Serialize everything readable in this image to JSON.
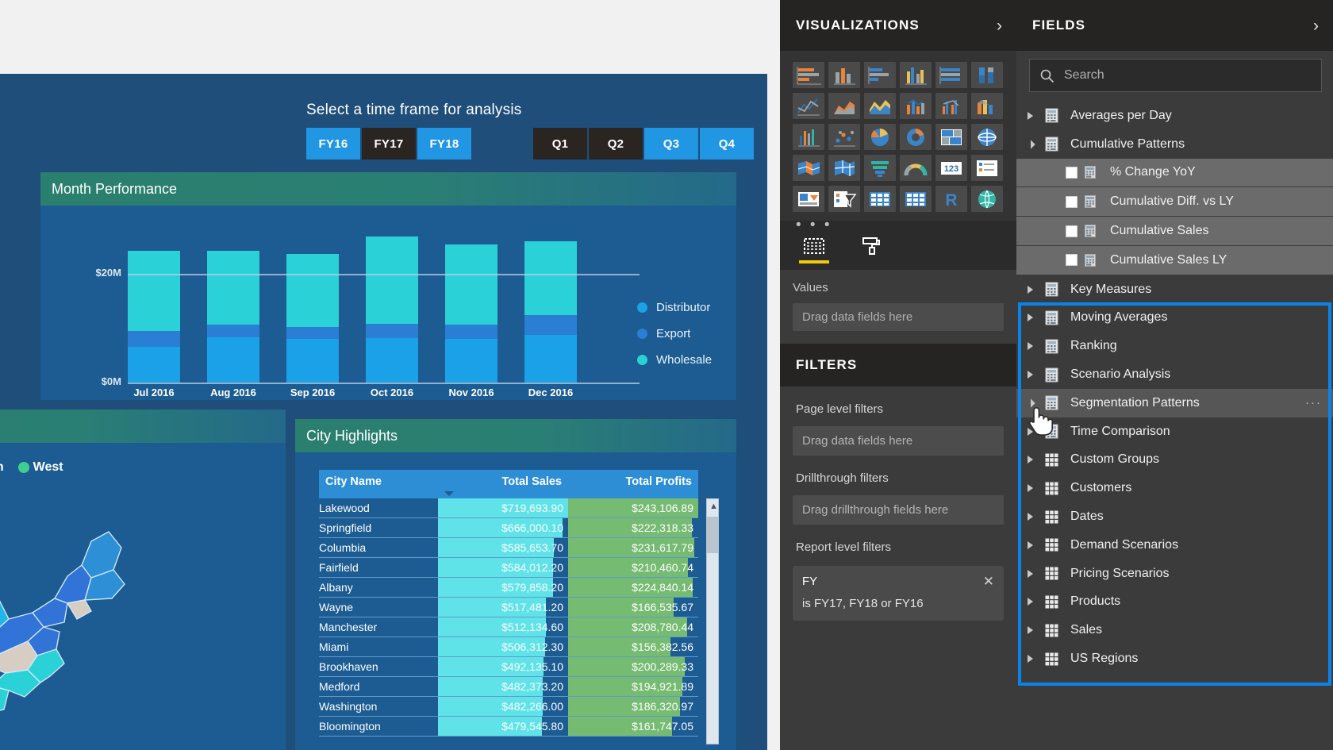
{
  "report": {
    "slicer": {
      "title": "Select a time frame for analysis",
      "fiscal_years": [
        {
          "label": "FY16",
          "selected": true
        },
        {
          "label": "FY17",
          "selected": false
        },
        {
          "label": "FY18",
          "selected": true
        }
      ],
      "quarters": [
        {
          "label": "Q1",
          "selected": false
        },
        {
          "label": "Q2",
          "selected": false
        },
        {
          "label": "Q3",
          "selected": true
        },
        {
          "label": "Q4",
          "selected": true
        }
      ]
    },
    "month_performance": {
      "title": "Month Performance"
    },
    "map_visual": {
      "legend_partial": "outh",
      "legend_west": "West"
    },
    "city_highlights": {
      "title": "City Highlights",
      "columns": [
        "City Name",
        "Total Sales",
        "Total Profits"
      ],
      "rows": [
        {
          "city": "Lakewood",
          "sales": "$719,693.90",
          "profits": "$243,106.89"
        },
        {
          "city": "Springfield",
          "sales": "$666,000.10",
          "profits": "$222,318.33"
        },
        {
          "city": "Columbia",
          "sales": "$585,653.70",
          "profits": "$231,617.79"
        },
        {
          "city": "Fairfield",
          "sales": "$584,012.20",
          "profits": "$210,460.74"
        },
        {
          "city": "Albany",
          "sales": "$579,858.20",
          "profits": "$224,840.14"
        },
        {
          "city": "Wayne",
          "sales": "$517,481.20",
          "profits": "$166,535.67"
        },
        {
          "city": "Manchester",
          "sales": "$512,134.60",
          "profits": "$208,780.44"
        },
        {
          "city": "Miami",
          "sales": "$506,312.30",
          "profits": "$156,382.56"
        },
        {
          "city": "Brookhaven",
          "sales": "$492,135.10",
          "profits": "$200,289.33"
        },
        {
          "city": "Medford",
          "sales": "$482,373.20",
          "profits": "$194,921.89"
        },
        {
          "city": "Washington",
          "sales": "$482,266.00",
          "profits": "$186,320.97"
        },
        {
          "city": "Bloomington",
          "sales": "$479,545.80",
          "profits": "$161,747.05"
        }
      ]
    }
  },
  "chart_data": {
    "type": "bar",
    "title": "Month Performance",
    "stacked": true,
    "categories": [
      "Jul 2016",
      "Aug 2016",
      "Sep 2016",
      "Oct 2016",
      "Nov 2016",
      "Dec 2016"
    ],
    "series": [
      {
        "name": "Distributor",
        "color": "#1ba1e8",
        "values": [
          6.6,
          8.4,
          8.0,
          8.2,
          8.0,
          8.8
        ]
      },
      {
        "name": "Export",
        "color": "#2a7fd4",
        "values": [
          2.9,
          2.3,
          2.2,
          2.6,
          2.7,
          3.6
        ]
      },
      {
        "name": "Wholesale",
        "color": "#2ad2d8",
        "values": [
          14.8,
          13.6,
          13.5,
          16.1,
          14.8,
          13.6
        ]
      }
    ],
    "ylabel": "",
    "xlabel": "",
    "ylim": [
      0,
      30
    ],
    "ytick_labels": [
      "$20M",
      "$0M"
    ],
    "grid": true,
    "legend_position": "right",
    "legend_entries": [
      "Distributor",
      "Export",
      "Wholesale"
    ]
  },
  "visualizations": {
    "header": "VISUALIZATIONS",
    "collapse_chevron": "›",
    "more_icons": "• • •",
    "gallery_icons": [
      "stacked-bar-chart-icon",
      "stacked-column-chart-icon",
      "clustered-bar-chart-icon",
      "clustered-column-chart-icon",
      "100-stacked-bar-chart-icon",
      "100-stacked-column-chart-icon",
      "line-chart-icon",
      "area-chart-icon",
      "stacked-area-chart-icon",
      "line-stacked-column-chart-icon",
      "line-clustered-column-chart-icon",
      "ribbon-chart-icon",
      "waterfall-chart-icon",
      "scatter-chart-icon",
      "pie-chart-icon",
      "donut-chart-icon",
      "treemap-icon",
      "map-icon",
      "filled-map-icon",
      "shape-map-icon",
      "funnel-chart-icon",
      "gauge-icon",
      "card-icon",
      "multi-row-card-icon",
      "kpi-icon",
      "slicer-icon",
      "table-icon",
      "matrix-icon",
      "r-script-visual-icon",
      "arcgis-maps-icon"
    ],
    "tabs": [
      {
        "name": "fields-tab",
        "icon": "fields-pane-icon",
        "active": true
      },
      {
        "name": "format-tab",
        "icon": "paint-roller-icon",
        "active": false
      }
    ],
    "well_label": "Values",
    "well_placeholder": "Drag data fields here"
  },
  "filters": {
    "header": "FILTERS",
    "page_level_label": "Page level filters",
    "page_level_placeholder": "Drag data fields here",
    "drillthrough_label": "Drillthrough filters",
    "drillthrough_placeholder": "Drag drillthrough fields here",
    "report_level_label": "Report level filters",
    "card": {
      "field": "FY",
      "condition": "is FY17, FY18 or FY16",
      "close": "✕"
    }
  },
  "fields": {
    "header": "FIELDS",
    "collapse_chevron": "›",
    "search_placeholder": "Search",
    "search_icon": "search-icon",
    "items": [
      {
        "label": "Averages per Day",
        "type": "measure-table",
        "expanded": false,
        "indent": 0,
        "highlighted": false
      },
      {
        "label": "Cumulative Patterns",
        "type": "measure-table",
        "expanded": true,
        "indent": 0,
        "highlighted": false
      },
      {
        "label": "% Change YoY",
        "type": "measure",
        "indent": 1,
        "checked": false
      },
      {
        "label": "Cumulative Diff. vs LY",
        "type": "measure",
        "indent": 1,
        "checked": false
      },
      {
        "label": "Cumulative Sales",
        "type": "measure",
        "indent": 1,
        "checked": false
      },
      {
        "label": "Cumulative Sales LY",
        "type": "measure",
        "indent": 1,
        "checked": false
      },
      {
        "label": "Key Measures",
        "type": "measure-table",
        "expanded": false,
        "indent": 0,
        "highlighted": false
      },
      {
        "label": "Moving Averages",
        "type": "measure-table",
        "expanded": false,
        "indent": 0,
        "highlighted": false
      },
      {
        "label": "Ranking",
        "type": "measure-table",
        "expanded": false,
        "indent": 0,
        "highlighted": false
      },
      {
        "label": "Scenario Analysis",
        "type": "measure-table",
        "expanded": false,
        "indent": 0,
        "highlighted": false
      },
      {
        "label": "Segmentation Patterns",
        "type": "measure-table",
        "expanded": true,
        "indent": 0,
        "highlighted": true,
        "ellipsis": "···"
      },
      {
        "label": "Time Comparison",
        "type": "measure-table",
        "expanded": false,
        "indent": 0,
        "highlighted": false
      },
      {
        "label": "Custom Groups",
        "type": "data-table",
        "expanded": false,
        "indent": 0,
        "highlighted": false
      },
      {
        "label": "Customers",
        "type": "data-table",
        "expanded": false,
        "indent": 0,
        "highlighted": false
      },
      {
        "label": "Dates",
        "type": "data-table",
        "expanded": false,
        "indent": 0,
        "highlighted": false
      },
      {
        "label": "Demand Scenarios",
        "type": "data-table",
        "expanded": false,
        "indent": 0,
        "highlighted": false
      },
      {
        "label": "Pricing Scenarios",
        "type": "data-table",
        "expanded": false,
        "indent": 0,
        "highlighted": false
      },
      {
        "label": "Products",
        "type": "data-table",
        "expanded": false,
        "indent": 0,
        "highlighted": false
      },
      {
        "label": "Sales",
        "type": "data-table",
        "expanded": false,
        "indent": 0,
        "highlighted": false
      },
      {
        "label": "US Regions",
        "type": "data-table",
        "expanded": false,
        "indent": 0,
        "highlighted": false
      }
    ],
    "selection_highlight_color": "#0a84e8",
    "cursor": "hand-pointer-cursor"
  }
}
